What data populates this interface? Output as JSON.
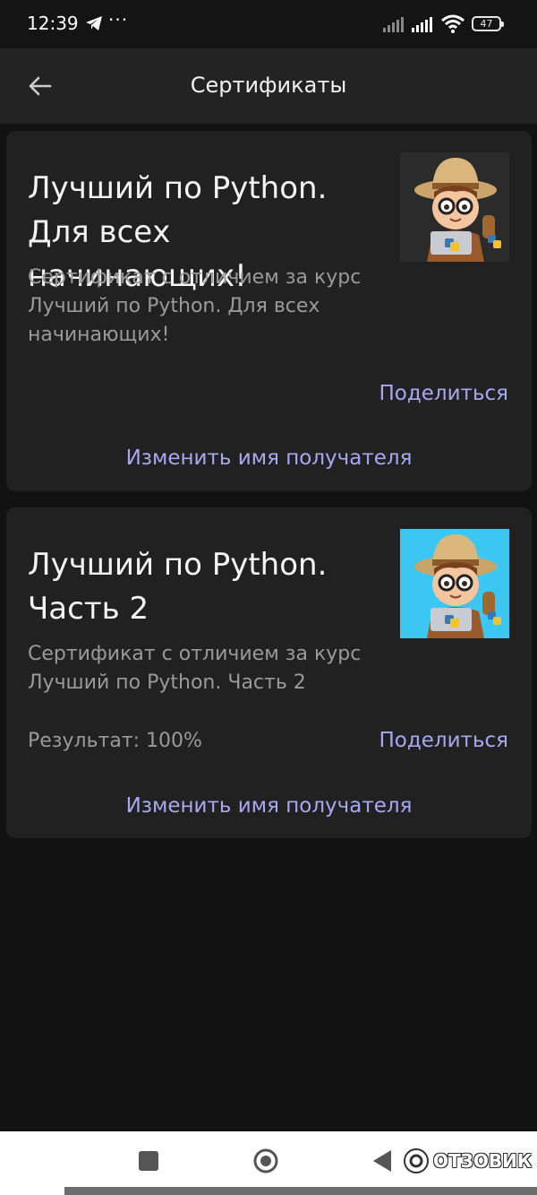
{
  "status_bar": {
    "time": "12:39",
    "more_dots": "···",
    "battery": "47",
    "icons": [
      "telegram-icon",
      "more-icon",
      "signal-icon",
      "signal-icon",
      "wifi-icon",
      "battery-icon"
    ]
  },
  "app_bar": {
    "title": "Сертификаты",
    "back_icon": "arrow-left-icon"
  },
  "certificates": [
    {
      "title": "Лучший по Python.\nДля всех начинающих!",
      "description": "Сертификат с отличием за курс\nЛучший по Python. Для всех\nначинающих!",
      "share_label": "Поделиться",
      "rename_label": "Изменить имя получателя",
      "image_background": "#2b2b2b"
    },
    {
      "title": "Лучший по Python.\nЧасть 2",
      "description": "Сертификат с отличием за курс\nЛучший по Python. Часть 2",
      "result": "Результат: 100%",
      "share_label": "Поделиться",
      "rename_label": "Изменить имя получателя",
      "image_background": "#3cc7f3"
    }
  ],
  "nav_bar": {
    "icons": [
      "recent-apps-icon",
      "home-icon",
      "back-icon"
    ]
  },
  "watermark": {
    "text": "ОТЗОВИК"
  },
  "colors": {
    "background": "#121212",
    "card": "#212121",
    "accent_link": "#a8a8f0",
    "secondary_text": "#9a9a9a"
  }
}
